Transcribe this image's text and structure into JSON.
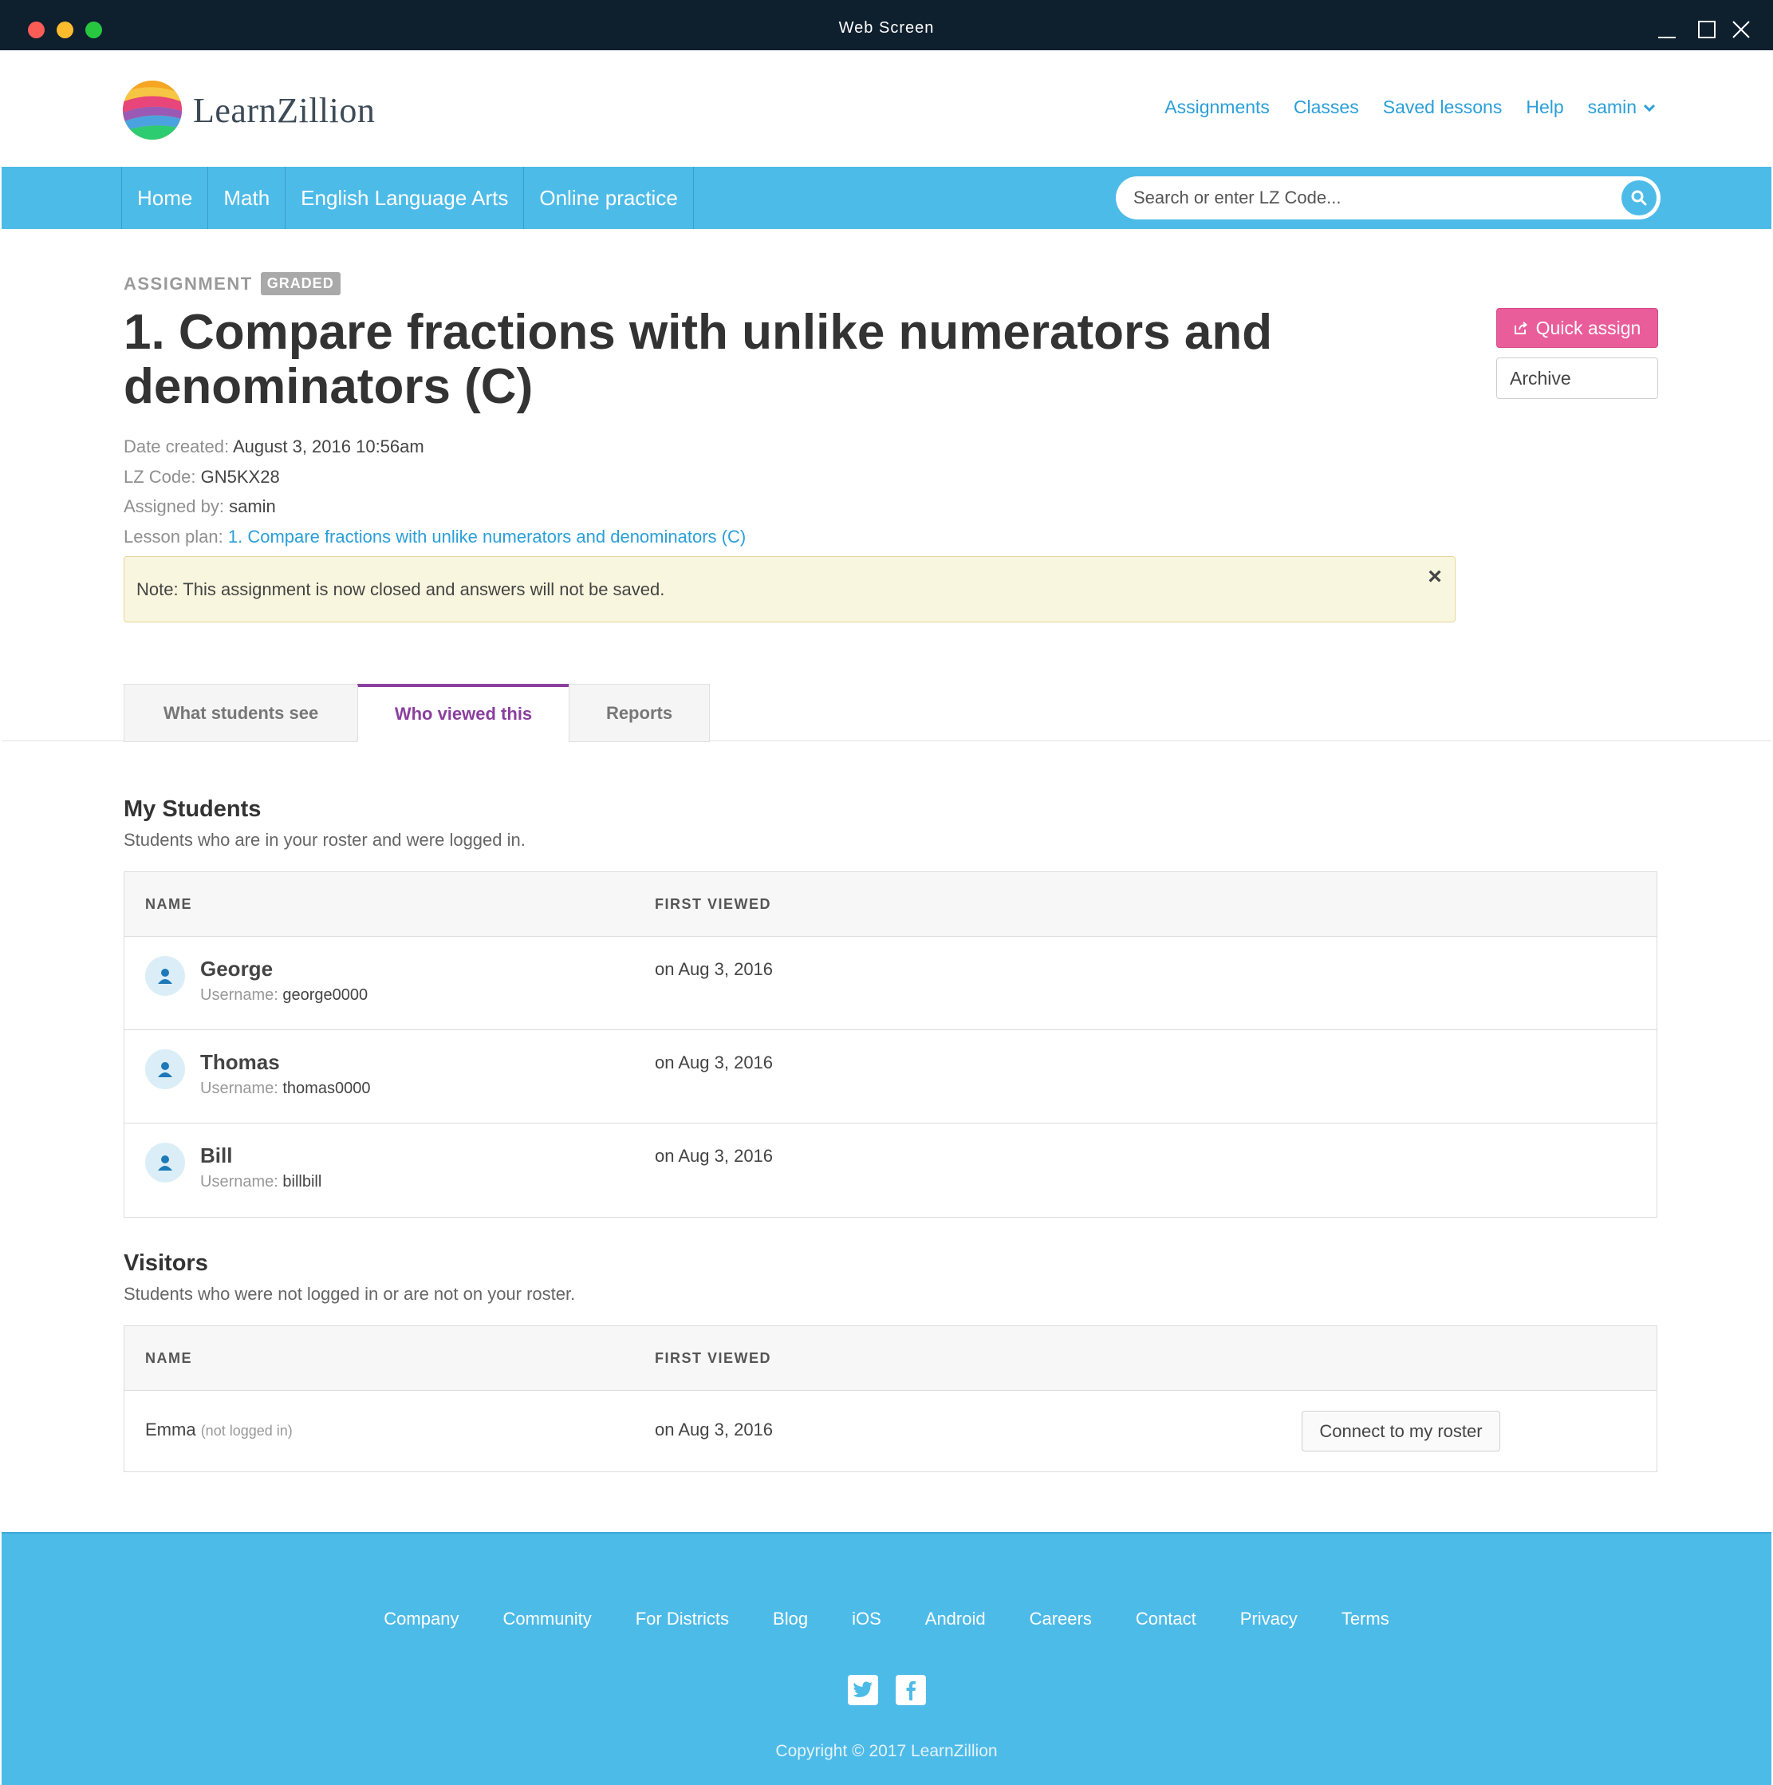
{
  "window": {
    "title": "Web Screen"
  },
  "brand": {
    "name": "LearnZillion"
  },
  "topnav": {
    "assignments": "Assignments",
    "classes": "Classes",
    "saved_lessons": "Saved lessons",
    "help": "Help",
    "user": "samin"
  },
  "mainnav": {
    "items": [
      "Home",
      "Math",
      "English Language Arts",
      "Online practice"
    ]
  },
  "search": {
    "placeholder": "Search or enter LZ Code..."
  },
  "assignment": {
    "eyebrow": "ASSIGNMENT",
    "badge": "GRADED",
    "title": "1. Compare fractions with unlike numerators and denominators (C)",
    "date_created_label": "Date created:",
    "date_created": "August 3, 2016 10:56am",
    "lz_code_label": "LZ Code:",
    "lz_code": "GN5KX28",
    "assigned_by_label": "Assigned by:",
    "assigned_by": "samin",
    "lesson_plan_label": "Lesson plan:",
    "lesson_plan": "1. Compare fractions with unlike numerators and denominators (C)"
  },
  "actions": {
    "quick_assign": "Quick assign",
    "archive": "Archive"
  },
  "note": {
    "text": "Note: This assignment is now closed and answers will not be saved."
  },
  "tabs": [
    "What students see",
    "Who viewed this",
    "Reports"
  ],
  "active_tab": "Who viewed this",
  "my_students": {
    "title": "My Students",
    "subtitle": "Students who are in your roster and were logged in.",
    "columns": [
      "NAME",
      "FIRST VIEWED"
    ],
    "username_label": "Username:",
    "rows": [
      {
        "name": "George",
        "username": "george0000",
        "first_viewed": "on Aug 3, 2016"
      },
      {
        "name": "Thomas",
        "username": "thomas0000",
        "first_viewed": "on Aug 3, 2016"
      },
      {
        "name": "Bill",
        "username": "billbill",
        "first_viewed": "on Aug 3, 2016"
      }
    ]
  },
  "visitors": {
    "title": "Visitors",
    "subtitle": "Students who were not logged in or are not on your roster.",
    "columns": [
      "NAME",
      "FIRST VIEWED"
    ],
    "rows": [
      {
        "name": "Emma",
        "status": "(not logged in)",
        "first_viewed": "on Aug 3, 2016",
        "action": "Connect to my roster"
      }
    ]
  },
  "footer": {
    "links": [
      "Company",
      "Community",
      "For Districts",
      "Blog",
      "iOS",
      "Android",
      "Careers",
      "Contact",
      "Privacy",
      "Terms"
    ],
    "social": [
      "twitter-icon",
      "facebook-icon"
    ],
    "copyright": "Copyright © 2017 LearnZillion"
  },
  "colors": {
    "nav_blue": "#4dbbe8",
    "link_blue": "#2a9fd8",
    "quick_assign_pink": "#ea5d9b",
    "active_tab_purple": "#8b3f9e",
    "note_bg": "#f8f6de"
  }
}
